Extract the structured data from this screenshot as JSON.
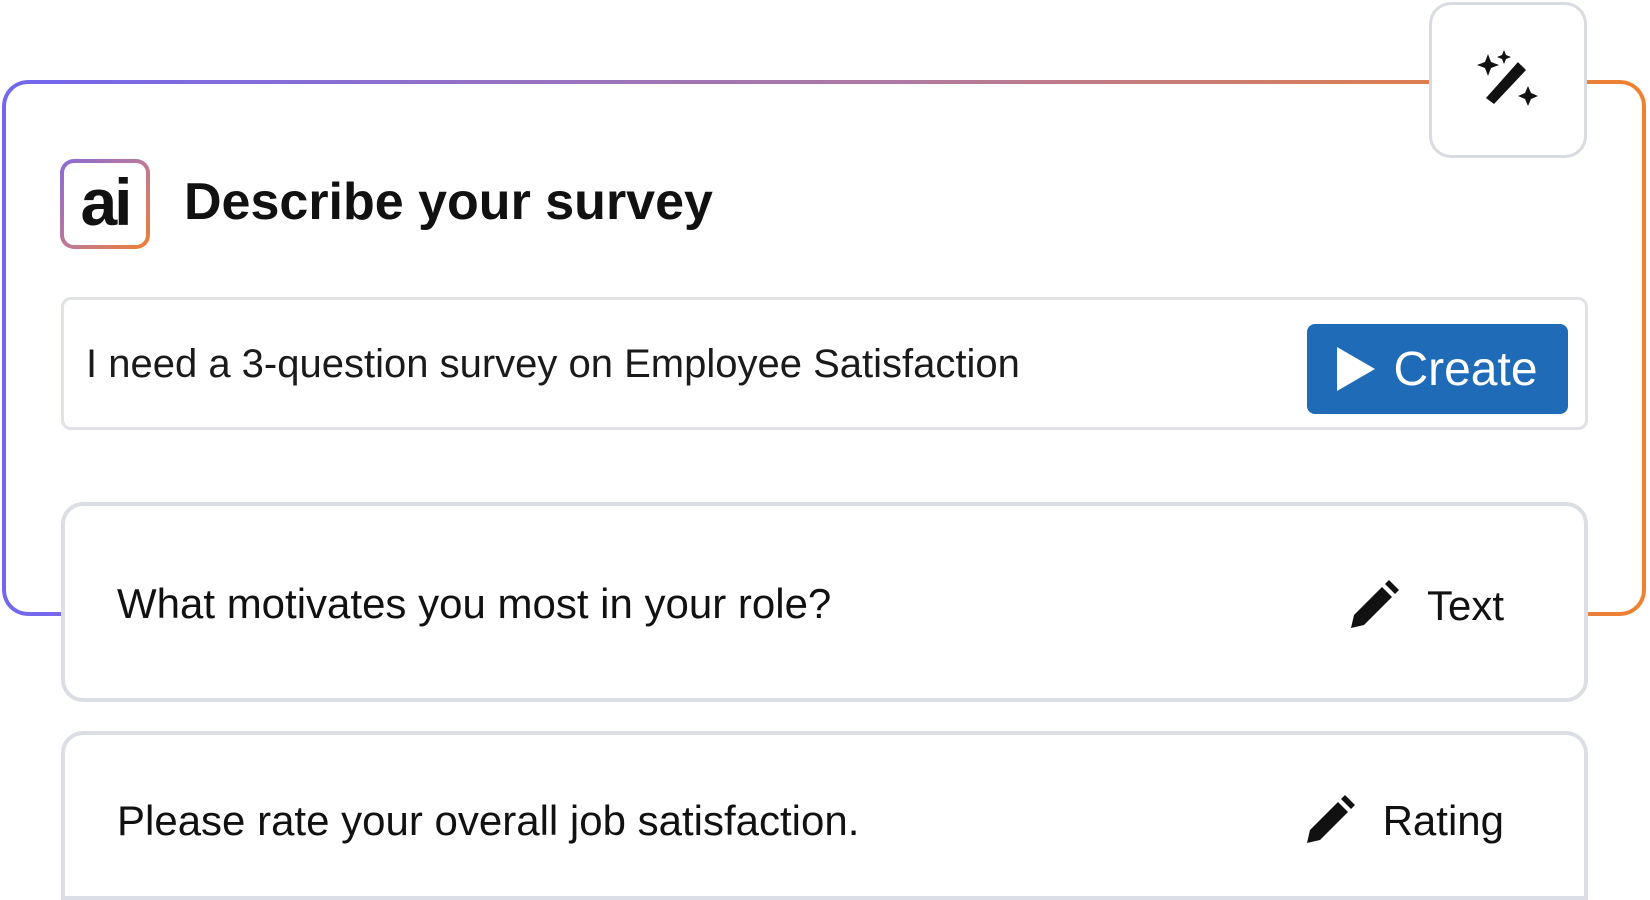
{
  "header": {
    "badge_text": "ai",
    "title": "Describe your survey"
  },
  "prompt": {
    "value": "I need a 3-question survey on Employee Satisfaction",
    "create_label": "Create"
  },
  "questions": [
    {
      "text": "What motivates you most in your role?",
      "type": "Text"
    },
    {
      "text": "Please rate your overall job satisfaction.",
      "type": "Rating"
    }
  ],
  "icons": {
    "wand": "magic-wand-icon",
    "play": "play-icon",
    "edit": "pencil-icon"
  },
  "colors": {
    "gradient_start": "#7367f0",
    "gradient_end": "#f08030",
    "primary_button": "#1f6bb8",
    "card_border": "#dcdee6"
  }
}
